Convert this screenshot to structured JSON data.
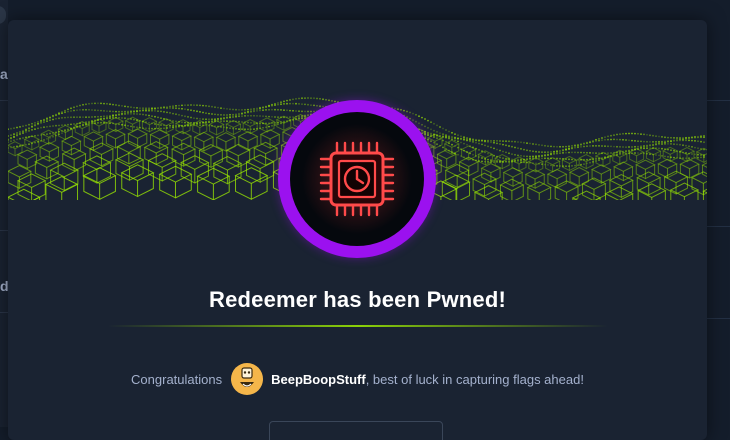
{
  "background": {
    "left_letters": [
      "a",
      "d"
    ]
  },
  "modal": {
    "badge_icon": "chip-clock-icon",
    "title": "Redeemer has been Pwned!",
    "congrats_prefix": "Congratulations",
    "username": "BeepBoopStuff",
    "congrats_suffix": ", best of luck in capturing flags ahead!"
  },
  "colors": {
    "page_bg": "#141d2b",
    "modal_bg": "#1a2332",
    "accent_green": "#9fef00",
    "badge_ring": "#9b11ef",
    "chip_red": "#ff3e3e",
    "text_muted": "#a4b1cd",
    "avatar": "#f5b64a"
  }
}
